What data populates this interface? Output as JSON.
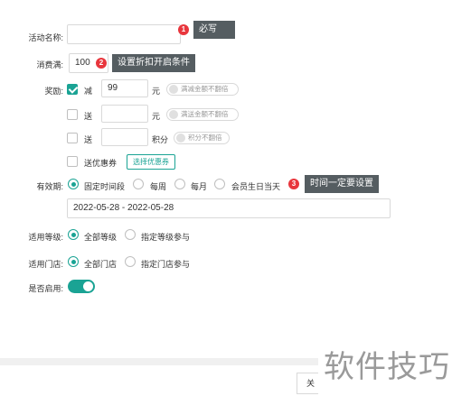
{
  "form": {
    "activity_name": {
      "label": "活动名称:",
      "value": ""
    },
    "spend_full": {
      "label": "消费满:",
      "value": "100"
    },
    "reward": {
      "label": "奖励:",
      "items": [
        {
          "checked": true,
          "label": "减",
          "value": "99",
          "unit": "元",
          "toggle_label": "满减金额不翻倍"
        },
        {
          "checked": false,
          "label": "送",
          "value": "",
          "unit": "元",
          "toggle_label": "满送金额不翻倍"
        },
        {
          "checked": false,
          "label": "送",
          "value": "",
          "unit": "积分",
          "toggle_label": "积分不翻倍"
        }
      ],
      "coupon": {
        "checked": false,
        "label": "送优惠券",
        "button": "选择优惠券"
      }
    },
    "validity": {
      "label": "有效期:",
      "options": [
        {
          "label": "固定时间段",
          "selected": true
        },
        {
          "label": "每周",
          "selected": false
        },
        {
          "label": "每月",
          "selected": false
        },
        {
          "label": "会员生日当天",
          "selected": false
        }
      ],
      "date_range": "2022-05-28 - 2022-05-28"
    },
    "level": {
      "label": "适用等级:",
      "options": [
        {
          "label": "全部等级",
          "selected": true
        },
        {
          "label": "指定等级参与",
          "selected": false
        }
      ]
    },
    "store": {
      "label": "适用门店:",
      "options": [
        {
          "label": "全部门店",
          "selected": true
        },
        {
          "label": "指定门店参与",
          "selected": false
        }
      ]
    },
    "enabled": {
      "label": "是否启用:",
      "on": true
    }
  },
  "annotations": [
    {
      "number": "1",
      "text": "必写"
    },
    {
      "number": "2",
      "text": "设置折扣开启条件"
    },
    {
      "number": "3",
      "text": "时间一定要设置"
    }
  ],
  "footer": {
    "close_label": "关"
  },
  "watermark": "软件技巧",
  "colors": {
    "accent": "#1aa394",
    "badge": "#e8363d",
    "tooltip": "#555d61"
  }
}
